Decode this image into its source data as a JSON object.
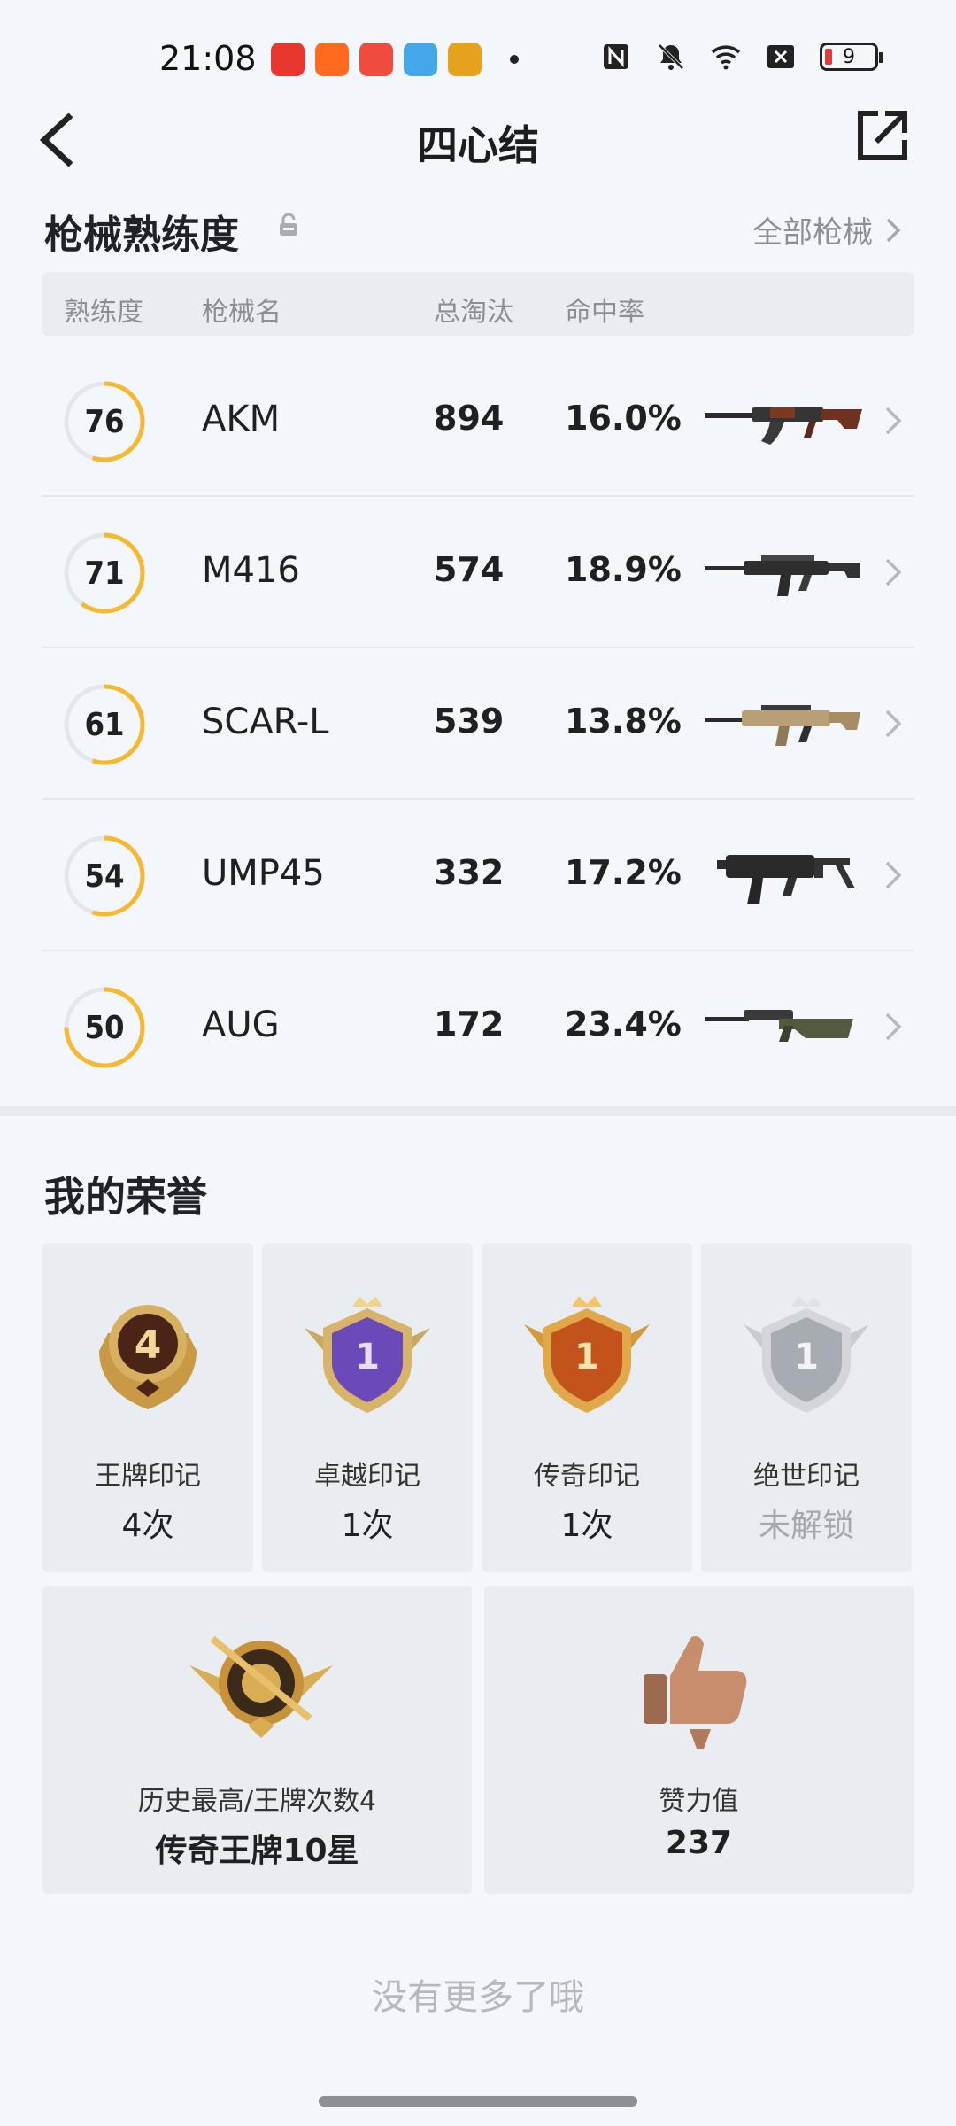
{
  "status_bar": {
    "time": "21:08",
    "battery": "9"
  },
  "header": {
    "title": "四心结"
  },
  "weapon_section": {
    "title": "枪械熟练度",
    "all_link": "全部枪械",
    "columns": [
      "熟练度",
      "枪械名",
      "总淘汰",
      "命中率"
    ],
    "weapons": [
      {
        "proficiency": "76",
        "name": "AKM",
        "kills": "894",
        "hit_rate": "16.0%",
        "progress": 0.55
      },
      {
        "proficiency": "71",
        "name": "M416",
        "kills": "574",
        "hit_rate": "18.9%",
        "progress": 0.6
      },
      {
        "proficiency": "61",
        "name": "SCAR-L",
        "kills": "539",
        "hit_rate": "13.8%",
        "progress": 0.55
      },
      {
        "proficiency": "54",
        "name": "UMP45",
        "kills": "332",
        "hit_rate": "17.2%",
        "progress": 0.55
      },
      {
        "proficiency": "50",
        "name": "AUG",
        "kills": "172",
        "hit_rate": "23.4%",
        "progress": 0.75
      }
    ]
  },
  "honors": {
    "title": "我的荣誉",
    "badges": [
      {
        "label": "王牌印记",
        "value": "4次",
        "badge_text": "4",
        "locked": false
      },
      {
        "label": "卓越印记",
        "value": "1次",
        "badge_text": "1",
        "locked": false
      },
      {
        "label": "传奇印记",
        "value": "1次",
        "badge_text": "1",
        "locked": false
      },
      {
        "label": "绝世印记",
        "value": "未解锁",
        "badge_text": "1",
        "locked": true
      }
    ],
    "highest": {
      "label": "历史最高/王牌次数4",
      "value": "传奇王牌10星"
    },
    "likes": {
      "label": "赞力值",
      "value": "237"
    }
  },
  "footer": {
    "no_more": "没有更多了哦"
  },
  "colors": {
    "ring_gold": "#f5b82e",
    "ring_track": "#e3e6ea",
    "accent": "#1e2024"
  }
}
